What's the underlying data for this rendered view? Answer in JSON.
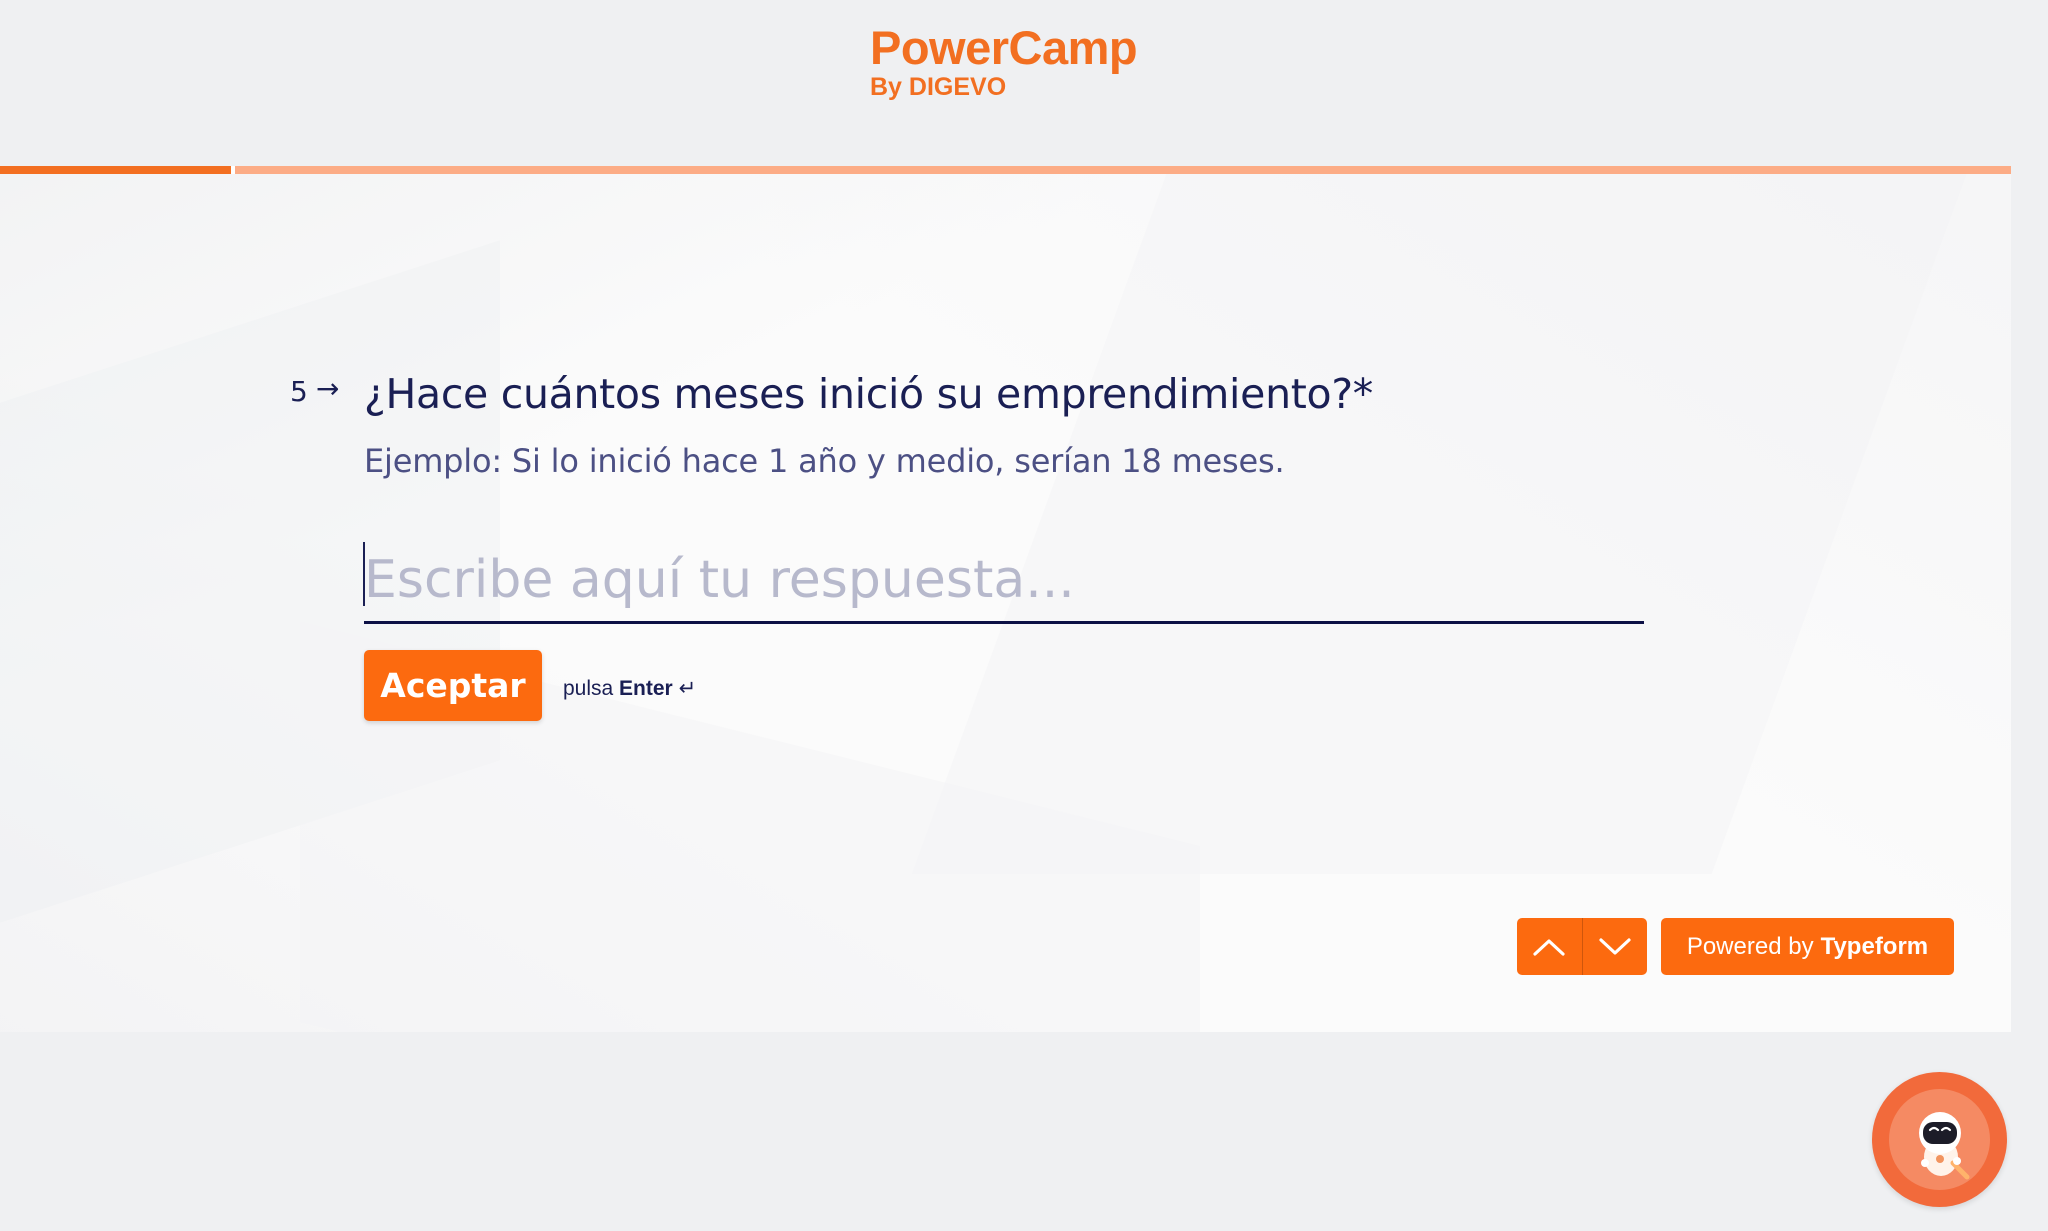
{
  "header": {
    "logo_main": "PowerCamp",
    "logo_sub": "By DIGEVO"
  },
  "progress": {
    "fraction": 0.115
  },
  "question": {
    "number": "5",
    "arrow": "→",
    "title": "¿Hace cuántos meses inició su emprendimiento?*",
    "description": "Ejemplo: Si lo inició hace 1 año y medio, serían 18 meses."
  },
  "answer": {
    "placeholder": "Escribe aquí tu respuesta...",
    "value": ""
  },
  "actions": {
    "accept_label": "Aceptar",
    "hint_prefix": "pulsa",
    "hint_key": "Enter",
    "hint_icon": "↵"
  },
  "footer": {
    "powered_prefix": "Powered by",
    "powered_brand": "Typeform",
    "prev_icon": "chevron-up-icon",
    "next_icon": "chevron-down-icon"
  },
  "colors": {
    "accent": "#fc6a0f",
    "brand": "#f26f21",
    "text": "#1a1f54",
    "progress_track": "#fcac86"
  }
}
